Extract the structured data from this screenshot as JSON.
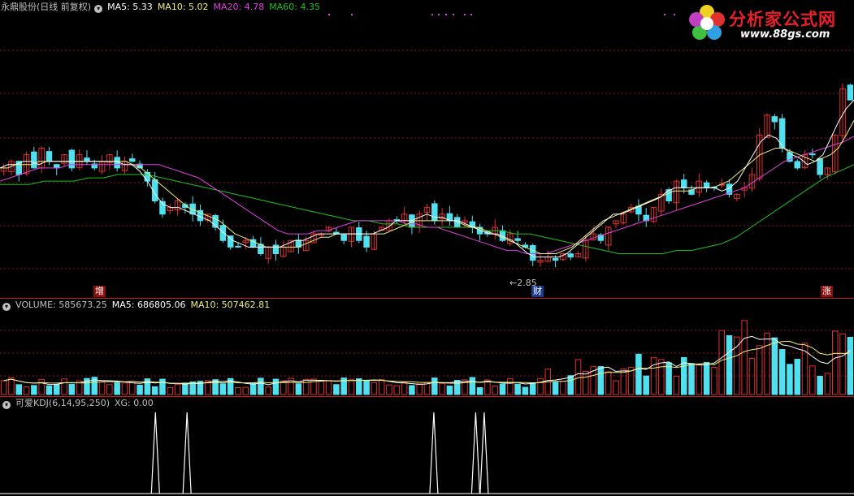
{
  "price_header": {
    "stock_name": "永鼎股份(日线 前复权)",
    "ma5": "MA5: 5.33",
    "ma10": "MA10: 5.02",
    "ma20": "MA20: 4.78",
    "ma60": "MA60: 4.35"
  },
  "volume_header": {
    "volume": "VOLUME: 585673.25",
    "ma5": "MA5: 686805.06",
    "ma10": "MA10: 507462.81"
  },
  "kdj_header": {
    "name": "可爱KDJ(6,14,95,250)",
    "xg": "XG: 0.00"
  },
  "markers": {
    "zeng": "增",
    "cai": "财",
    "zhang": "涨",
    "low_price": "←2.85"
  },
  "logo": {
    "title": "分析家公式网",
    "url": "www.88gs.com"
  },
  "colors": {
    "up": "#e03030",
    "down": "#50e0f0",
    "ma5": "#ffffff",
    "ma10": "#f0f080",
    "ma20": "#e040e0",
    "ma60": "#20c020",
    "grid": "#8a1a1a",
    "kdj_signal": "#ffffff"
  },
  "chart_data": {
    "type": "candlestick",
    "price_range": [
      2.6,
      6.6
    ],
    "close": [
      4.3,
      4.4,
      4.2,
      4.5,
      4.3,
      4.6,
      4.4,
      4.3,
      4.5,
      4.3,
      4.5,
      4.4,
      4.3,
      4.4,
      4.5,
      4.3,
      4.4,
      4.4,
      4.3,
      4.1,
      3.8,
      3.6,
      3.7,
      3.8,
      3.7,
      3.6,
      3.5,
      3.6,
      3.4,
      3.2,
      3.1,
      3.1,
      3.2,
      3.1,
      3.0,
      3.1,
      3.0,
      3.1,
      3.2,
      3.1,
      3.2,
      3.3,
      3.3,
      3.4,
      3.3,
      3.2,
      3.4,
      3.2,
      3.1,
      3.3,
      3.4,
      3.5,
      3.5,
      3.6,
      3.4,
      3.6,
      3.7,
      3.5,
      3.6,
      3.5,
      3.4,
      3.5,
      3.4,
      3.3,
      3.3,
      3.4,
      3.2,
      3.3,
      3.2,
      3.1,
      2.9,
      2.9,
      2.95,
      2.9,
      3.0,
      2.95,
      3.0,
      3.2,
      3.3,
      3.2,
      3.4,
      3.5,
      3.6,
      3.7,
      3.6,
      3.5,
      3.7,
      3.9,
      3.8,
      4.1,
      4.0,
      3.9,
      4.1,
      4.0,
      4.0,
      4.05,
      3.9,
      3.9,
      4.0,
      4.2,
      4.8,
      5.1,
      5.0,
      4.6,
      4.4,
      4.3,
      4.5,
      4.5,
      4.2,
      4.3,
      4.8,
      5.5,
      5.33
    ],
    "ma5": [
      4.3,
      4.35,
      4.35,
      4.4,
      4.4,
      4.35,
      4.4,
      4.4,
      4.4,
      4.4,
      4.4,
      4.4,
      4.4,
      4.4,
      4.4,
      4.4,
      4.35,
      4.35,
      4.25,
      4.1,
      3.9,
      3.75,
      3.7,
      3.7,
      3.65,
      3.6,
      3.55,
      3.5,
      3.4,
      3.3,
      3.2,
      3.15,
      3.1,
      3.1,
      3.1,
      3.1,
      3.1,
      3.15,
      3.2,
      3.2,
      3.25,
      3.3,
      3.3,
      3.3,
      3.3,
      3.3,
      3.3,
      3.3,
      3.3,
      3.35,
      3.4,
      3.5,
      3.5,
      3.5,
      3.55,
      3.6,
      3.55,
      3.55,
      3.5,
      3.5,
      3.45,
      3.4,
      3.35,
      3.3,
      3.3,
      3.25,
      3.2,
      3.1,
      3.0,
      2.95,
      2.95,
      2.95,
      2.95,
      3.0,
      3.1,
      3.2,
      3.3,
      3.4,
      3.5,
      3.6,
      3.6,
      3.65,
      3.7,
      3.75,
      3.8,
      3.85,
      3.95,
      4.0,
      4.0,
      4.0,
      4.0,
      4.0,
      4.0,
      3.95,
      4.0,
      4.1,
      4.3,
      4.5,
      4.7,
      4.8,
      4.75,
      4.6,
      4.5,
      4.45,
      4.35,
      4.4,
      4.5,
      4.75,
      5.0,
      5.2,
      5.33
    ],
    "ma10": [
      4.3,
      4.3,
      4.35,
      4.35,
      4.35,
      4.4,
      4.4,
      4.4,
      4.4,
      4.4,
      4.4,
      4.4,
      4.4,
      4.4,
      4.4,
      4.4,
      4.4,
      4.35,
      4.3,
      4.2,
      4.1,
      4.0,
      3.9,
      3.8,
      3.7,
      3.65,
      3.6,
      3.55,
      3.5,
      3.4,
      3.3,
      3.25,
      3.2,
      3.15,
      3.1,
      3.1,
      3.1,
      3.1,
      3.1,
      3.15,
      3.2,
      3.25,
      3.25,
      3.3,
      3.3,
      3.3,
      3.3,
      3.3,
      3.3,
      3.3,
      3.35,
      3.4,
      3.45,
      3.5,
      3.5,
      3.5,
      3.5,
      3.5,
      3.5,
      3.45,
      3.4,
      3.4,
      3.35,
      3.3,
      3.25,
      3.2,
      3.15,
      3.1,
      3.05,
      3.0,
      3.0,
      3.0,
      3.05,
      3.1,
      3.2,
      3.3,
      3.4,
      3.5,
      3.55,
      3.6,
      3.65,
      3.7,
      3.75,
      3.8,
      3.85,
      3.9,
      3.95,
      3.95,
      3.95,
      4.0,
      4.0,
      4.0,
      4.05,
      4.1,
      4.2,
      4.3,
      4.4,
      4.5,
      4.55,
      4.6,
      4.6,
      4.55,
      4.5,
      4.45,
      4.4,
      4.45,
      4.5,
      4.6,
      4.8,
      5.02
    ],
    "ma20": [
      4.1,
      4.15,
      4.2,
      4.25,
      4.3,
      4.3,
      4.3,
      4.35,
      4.35,
      4.35,
      4.35,
      4.35,
      4.35,
      4.35,
      4.35,
      4.35,
      4.35,
      4.3,
      4.25,
      4.2,
      4.15,
      4.05,
      3.95,
      3.85,
      3.75,
      3.65,
      3.55,
      3.45,
      3.35,
      3.3,
      3.3,
      3.3,
      3.35,
      3.35,
      3.4,
      3.45,
      3.5,
      3.5,
      3.5,
      3.5,
      3.5,
      3.45,
      3.45,
      3.4,
      3.4,
      3.35,
      3.3,
      3.25,
      3.2,
      3.15,
      3.1,
      3.05,
      3.05,
      3.0,
      3.0,
      3.0,
      3.05,
      3.1,
      3.15,
      3.2,
      3.25,
      3.3,
      3.35,
      3.4,
      3.45,
      3.5,
      3.55,
      3.6,
      3.65,
      3.7,
      3.75,
      3.8,
      3.85,
      3.9,
      3.95,
      4.0,
      4.1,
      4.2,
      4.3,
      4.4,
      4.45,
      4.5,
      4.55,
      4.6,
      4.65,
      4.7,
      4.78
    ],
    "ma60": [
      4.05,
      4.05,
      4.05,
      4.1,
      4.1,
      4.1,
      4.15,
      4.15,
      4.2,
      4.2,
      4.2,
      4.15,
      4.1,
      4.05,
      4.0,
      3.95,
      3.9,
      3.85,
      3.8,
      3.75,
      3.7,
      3.65,
      3.6,
      3.55,
      3.5,
      3.5,
      3.45,
      3.45,
      3.4,
      3.4,
      3.4,
      3.4,
      3.4,
      3.35,
      3.35,
      3.3,
      3.3,
      3.25,
      3.2,
      3.15,
      3.1,
      3.05,
      3.0,
      3.0,
      3.0,
      3.0,
      3.05,
      3.05,
      3.1,
      3.15,
      3.25,
      3.4,
      3.55,
      3.7,
      3.85,
      4.0,
      4.15,
      4.25,
      4.35
    ],
    "volume_ma5_note": "",
    "kdj_signal_positions": [
      0.182,
      0.219,
      0.508,
      0.557,
      0.567
    ]
  }
}
